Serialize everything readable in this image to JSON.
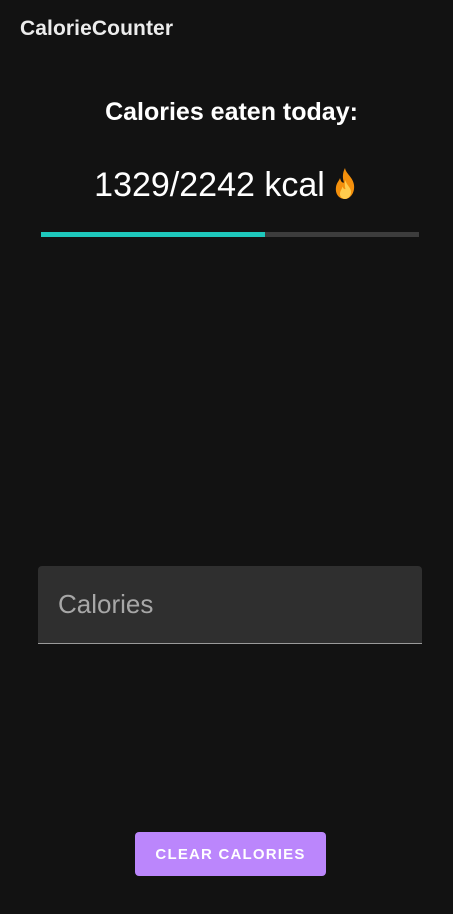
{
  "app": {
    "title": "CalorieCounter"
  },
  "summary": {
    "heading": "Calories eaten today:",
    "counter_text": "1329/2242 kcal",
    "consumed": 1329,
    "goal": 2242,
    "unit": "kcal",
    "icon": "flame-icon"
  },
  "progress": {
    "fraction": 0.593,
    "fill_color": "#1ec8bc",
    "track_color": "#3c3c3c"
  },
  "input": {
    "placeholder": "Calories",
    "value": ""
  },
  "actions": {
    "clear_label": "CLEAR CALORIES",
    "clear_color": "#bb86fc"
  },
  "theme": {
    "background": "#121212"
  }
}
